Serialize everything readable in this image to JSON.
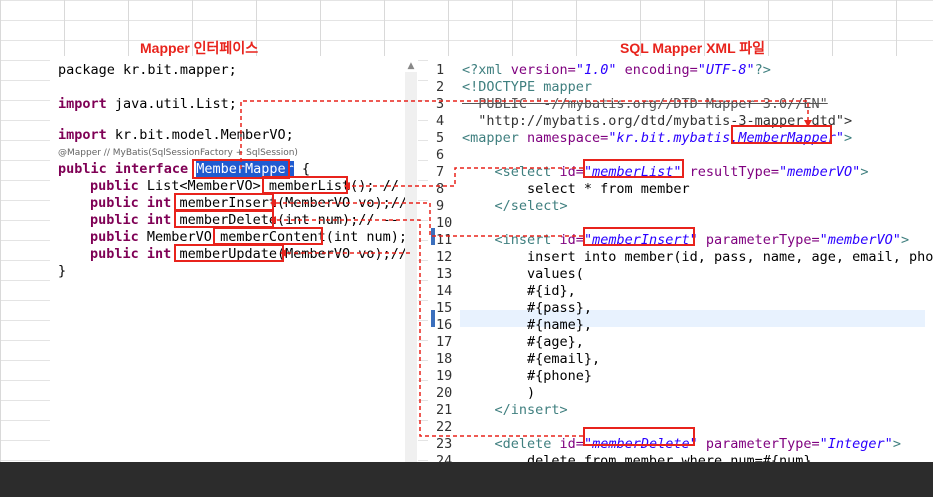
{
  "titles": {
    "left": "Mapper 인터페이스",
    "right": "SQL Mapper XML 파일"
  },
  "left_code": {
    "line1": "package kr.bit.mapper;",
    "line2_kw": "import",
    "line2_rest": " java.util.List;",
    "line3_kw": "import",
    "line3_rest": " kr.bit.model.MemberVO;",
    "annotation": "@Mapper // MyBatis(SqlSessionFactory + SqlSession)",
    "iface_kw1": "public",
    "iface_kw2": "interface",
    "iface_name": "MemberMapper",
    "iface_brace": " {",
    "m1_kw": "public",
    "m1_a": " List<MemberVO> ",
    "m1_name": "memberList",
    "m1_b": "();",
    "m1_c": " //",
    "m2_kw1": "public",
    "m2_kw2": "int",
    "m2_name": "memberInsert",
    "m2_b": "(MemberVO vo);",
    "m2_c": "//",
    "m3_kw1": "public",
    "m3_kw2": "int",
    "m3_name": "memberDelete",
    "m3_b": "(int num);",
    "m3_c": "// -- S",
    "m4_kw": "public",
    "m4_a": " MemberVO ",
    "m4_name": "memberContent",
    "m4_b": "(int num);",
    "m5_kw1": "public",
    "m5_kw2": "int",
    "m5_name": "memberUpdate",
    "m5_b": "(MemberVO vo);",
    "m5_c": "//",
    "close": "}"
  },
  "xml_code": {
    "ln": [
      "1",
      "2",
      "3",
      "4",
      "5",
      "6",
      "7",
      "8",
      "9",
      "10",
      "11",
      "12",
      "13",
      "14",
      "15",
      "16",
      "17",
      "18",
      "19",
      "20",
      "21",
      "22",
      "23",
      "24"
    ],
    "l1_a": "<?xml ",
    "l1_b": "version=",
    "l1_c": "\"1.0\"",
    "l1_d": " encoding=",
    "l1_e": "\"UTF-8\"",
    "l1_f": "?>",
    "l2": "<!DOCTYPE mapper",
    "l3": "  PUBLIC \"-//mybatis.org//DTD Mapper 3.0//EN\"",
    "l4": "  \"http://mybatis.org/dtd/mybatis-3-mapper.dtd\">",
    "l5_a": "<mapper ",
    "l5_b": "namespace=",
    "l5_c": "\"kr.bit.mybatis.",
    "l5_d": "MemberMapper",
    "l5_e": "\"",
    "l5_f": ">",
    "l7_a": "    <select ",
    "l7_b": "id=",
    "l7_c": "\"memberList\"",
    "l7_d": " resultType=",
    "l7_e": "\"memberVO\"",
    "l7_f": ">",
    "l8": "        select * from member",
    "l9": "    </select>",
    "l11_a": "    <insert ",
    "l11_b": "id=",
    "l11_c": "\"memberInsert\"",
    "l11_d": " parameterType=",
    "l11_e": "\"memberVO\"",
    "l11_f": ">",
    "l12": "        insert into member(id, pass, name, age, email, pho",
    "l13": "        values(",
    "l14": "        #{id},",
    "l15": "        #{pass},",
    "l16": "        #{name},",
    "l17": "        #{age},",
    "l18": "        #{email},",
    "l19": "        #{phone}",
    "l20": "        )",
    "l21": "    </insert>",
    "l23_a": "    <delete ",
    "l23_b": "id=",
    "l23_c": "\"memberDelete\"",
    "l23_d": " parameterType=",
    "l23_e": "\"Integer\"",
    "l23_f": ">",
    "l24": "        delete from member where num=#{num}"
  },
  "colors": {
    "accent_red": "#e8231c",
    "keyword": "#7f0055",
    "xml_tag": "#3f7f7f",
    "xml_attr": "#7f007f",
    "xml_value": "#2a00ff",
    "selection": "#1f5bd1"
  }
}
